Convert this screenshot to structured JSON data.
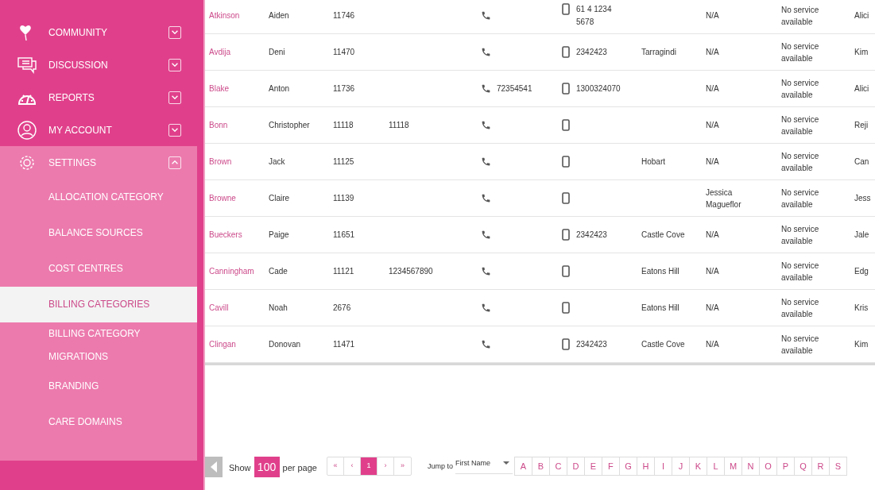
{
  "sidebar": {
    "items": [
      {
        "label": "COMMUNITY",
        "expanded": false
      },
      {
        "label": "DISCUSSION",
        "expanded": false
      },
      {
        "label": "REPORTS",
        "expanded": false
      },
      {
        "label": "MY ACCOUNT",
        "expanded": false
      },
      {
        "label": "SETTINGS",
        "expanded": true,
        "children": [
          {
            "label": "ALLOCATION CATEGORY",
            "selected": false
          },
          {
            "label": "BALANCE SOURCES",
            "selected": false
          },
          {
            "label": "COST CENTRES",
            "selected": false
          },
          {
            "label": "BILLING CATEGORIES",
            "selected": true
          },
          {
            "label": "BILLING CATEGORY MIGRATIONS",
            "selected": false
          },
          {
            "label": "BRANDING",
            "selected": false
          },
          {
            "label": "CARE DOMAINS",
            "selected": false
          }
        ]
      }
    ]
  },
  "table": {
    "rows": [
      {
        "last_name": "Atkinson",
        "first_name": "Aiden",
        "id": "11746",
        "column_4": "",
        "phone": "",
        "mobile": "61 4 1234 5678",
        "suburb": "",
        "column_8": "N/A",
        "service": "No service available",
        "column_10": "Alici"
      },
      {
        "last_name": "Avdija",
        "first_name": "Deni",
        "id": "11470",
        "column_4": "",
        "phone": "",
        "mobile": "2342423",
        "suburb": "Tarragindi",
        "column_8": "N/A",
        "service": "No service available",
        "column_10": "Kim"
      },
      {
        "last_name": "Blake",
        "first_name": "Anton",
        "id": "11736",
        "column_4": "",
        "phone": "72354541",
        "mobile": "1300324070",
        "suburb": "",
        "column_8": "N/A",
        "service": "No service available",
        "column_10": "Alici"
      },
      {
        "last_name": "Bonn",
        "first_name": "Christopher",
        "id": "11118",
        "column_4": "11118",
        "phone": "",
        "mobile": "",
        "suburb": "",
        "column_8": "N/A",
        "service": "No service available",
        "column_10": "Reji"
      },
      {
        "last_name": "Brown",
        "first_name": "Jack",
        "id": "11125",
        "column_4": "",
        "phone": "",
        "mobile": "",
        "suburb": "Hobart",
        "column_8": "N/A",
        "service": "No service available",
        "column_10": "Can"
      },
      {
        "last_name": "Browne",
        "first_name": "Claire",
        "id": "11139",
        "column_4": "",
        "phone": "",
        "mobile": "",
        "suburb": "",
        "column_8": "Jessica Magueflor",
        "service": "No service available",
        "column_10": "Jess"
      },
      {
        "last_name": "Bueckers",
        "first_name": "Paige",
        "id": "11651",
        "column_4": "",
        "phone": "",
        "mobile": "2342423",
        "suburb": "Castle Cove",
        "column_8": "N/A",
        "service": "No service available",
        "column_10": "Jale"
      },
      {
        "last_name": "Canningham",
        "first_name": "Cade",
        "id": "11121",
        "column_4": "1234567890",
        "phone": "",
        "mobile": "",
        "suburb": "Eatons Hill",
        "column_8": "N/A",
        "service": "No service available",
        "column_10": "Edg"
      },
      {
        "last_name": "Cavill",
        "first_name": "Noah",
        "id": "2676",
        "column_4": "",
        "phone": "",
        "mobile": "",
        "suburb": "Eatons Hill",
        "column_8": "N/A",
        "service": "No service available",
        "column_10": "Kris"
      },
      {
        "last_name": "Clingan",
        "first_name": "Donovan",
        "id": "11471",
        "column_4": "",
        "phone": "",
        "mobile": "2342423",
        "suburb": "Castle Cove",
        "column_8": "N/A",
        "service": "No service available",
        "column_10": "Kim"
      }
    ]
  },
  "pagination": {
    "show_label": "Show",
    "per_page": "100",
    "per_page_label": "per page",
    "pages": [
      {
        "label": "«",
        "selected": false
      },
      {
        "label": "‹",
        "selected": false
      },
      {
        "label": "1",
        "selected": true
      },
      {
        "label": "›",
        "selected": false
      },
      {
        "label": "»",
        "selected": false
      }
    ],
    "jump_label": "Jump to",
    "jump_field": "First Name",
    "letters": [
      "A",
      "B",
      "C",
      "D",
      "E",
      "F",
      "G",
      "H",
      "I",
      "J",
      "K",
      "L",
      "M",
      "N",
      "O",
      "P",
      "Q",
      "R",
      "S"
    ]
  }
}
